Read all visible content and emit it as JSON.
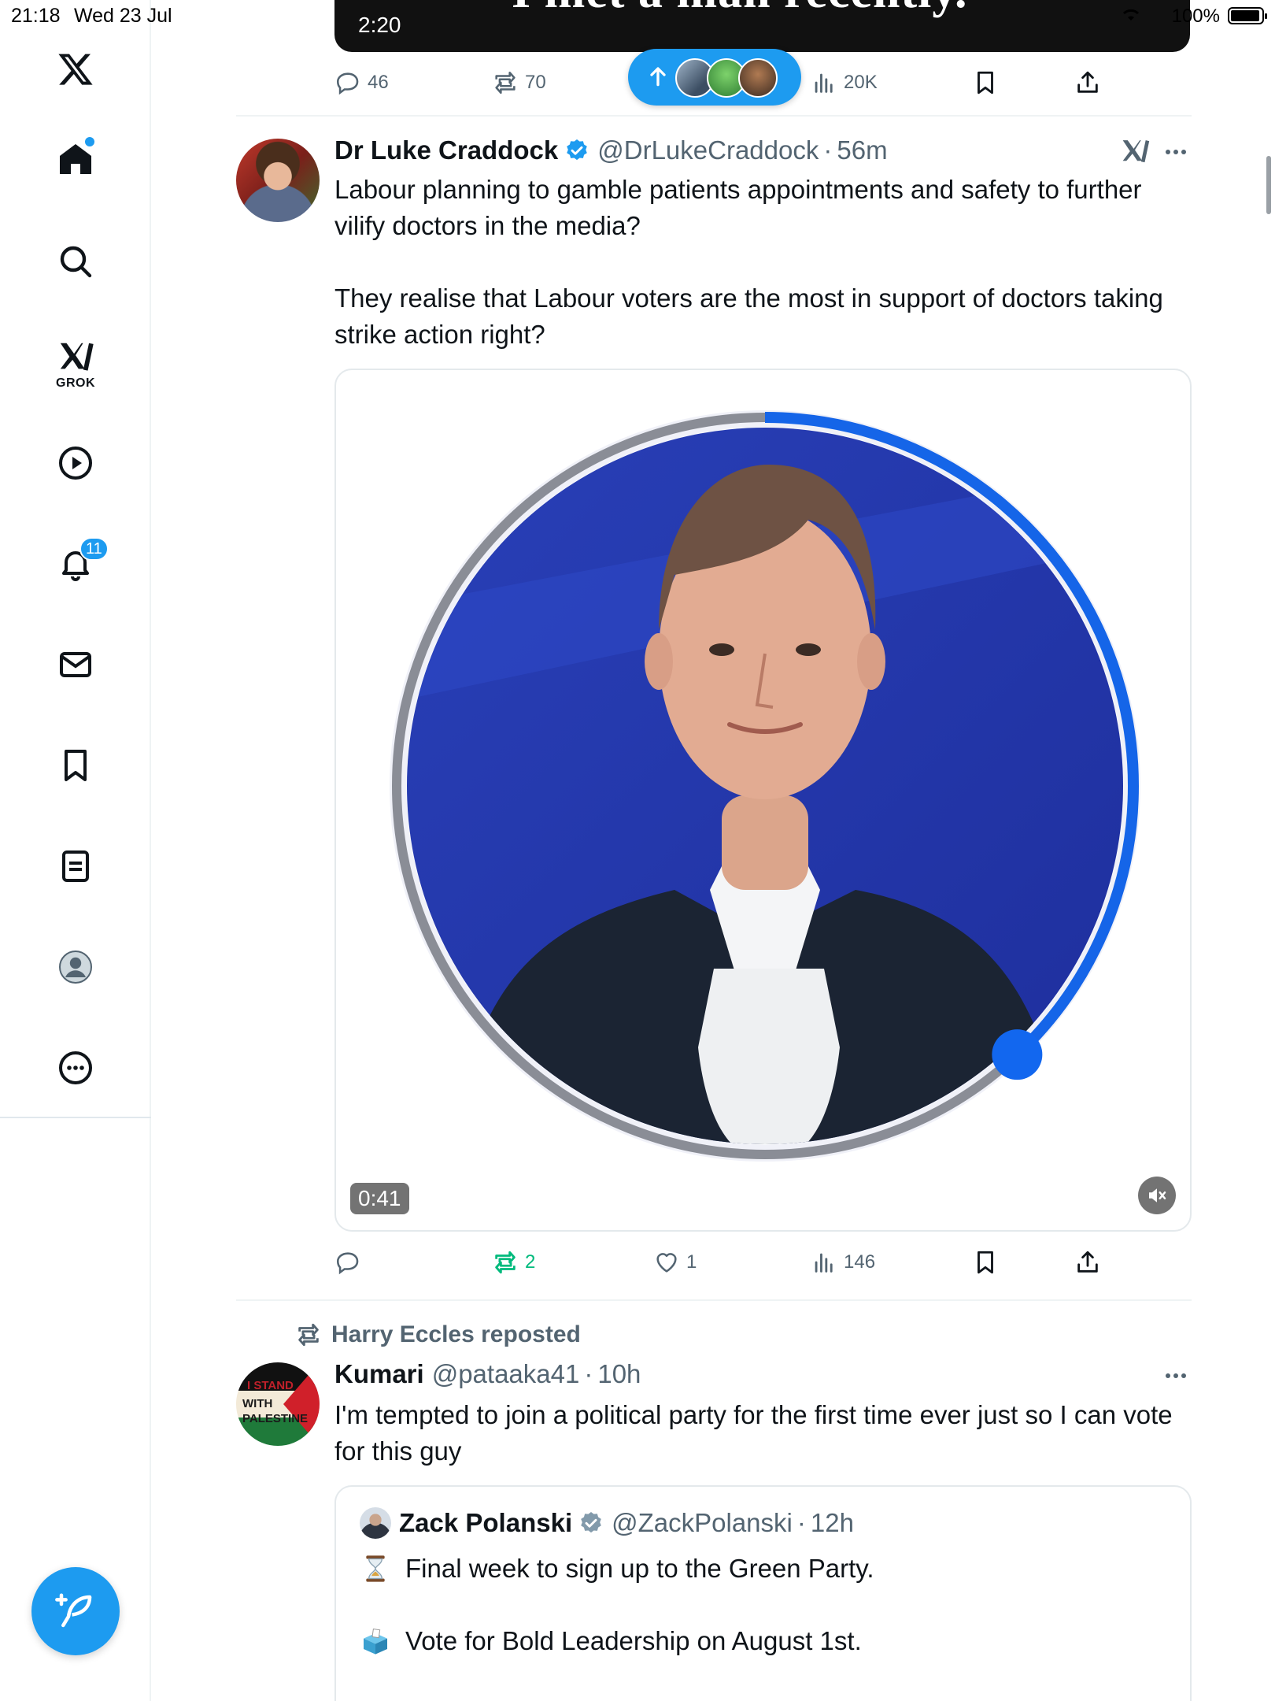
{
  "status_bar": {
    "time": "21:18",
    "date": "Wed 23 Jul",
    "battery": "100%"
  },
  "sidebar": {
    "notification_count": "11",
    "grok_label": "GROK",
    "items": [
      {
        "name": "logo",
        "icon": "x-logo-icon"
      },
      {
        "name": "home",
        "icon": "home-icon"
      },
      {
        "name": "explore",
        "icon": "search-icon"
      },
      {
        "name": "grok",
        "icon": "grok-icon"
      },
      {
        "name": "video",
        "icon": "play-icon"
      },
      {
        "name": "notifications",
        "icon": "bell-icon"
      },
      {
        "name": "messages",
        "icon": "mail-icon"
      },
      {
        "name": "bookmarks",
        "icon": "bookmark-icon"
      },
      {
        "name": "lists",
        "icon": "list-icon"
      },
      {
        "name": "profile",
        "icon": "profile-icon"
      },
      {
        "name": "more",
        "icon": "more-icon"
      }
    ],
    "compose_icon": "compose-icon"
  },
  "previous_tweet": {
    "video_caption": "I met a man recently.",
    "video_time": "2:20",
    "replies": "46",
    "reposts": "70",
    "views": "20K"
  },
  "new_posts_pill": {
    "icon": "arrow-up-icon",
    "avatars": 3
  },
  "tweet1": {
    "name": "Dr Luke Craddock",
    "handle": "@DrLukeCraddock",
    "time": "56m",
    "verified": true,
    "text": "Labour planning to gamble patients appointments and safety to further vilify doctors in the media?\n\nThey realise that Labour voters are the most in support of doctors taking strike action right?",
    "video_time": "0:41",
    "video_progress": 0.38,
    "replies": "",
    "reposts": "2",
    "likes": "1",
    "views": "146"
  },
  "tweet2": {
    "repost_label": "Harry Eccles reposted",
    "name": "Kumari",
    "handle": "@pataaka41",
    "time": "10h",
    "avatar_text": [
      "I STAND",
      "WITH",
      "PALESTINE"
    ],
    "text": "I'm tempted to join a political party for the first time ever just so I can vote for this guy",
    "quote": {
      "name": "Zack Polanski",
      "handle": "@ZackPolanski",
      "time": "12h",
      "line1": "Final week to sign up to the Green Party.",
      "line2": "Vote for Bold Leadership on August 1st.",
      "emoji1": "hourglass-icon",
      "emoji2": "ballot-box-icon"
    }
  },
  "colors": {
    "accent": "#1d9bf0",
    "text": "#0f1419",
    "muted": "#536471",
    "repost_green": "#00ba7c"
  }
}
